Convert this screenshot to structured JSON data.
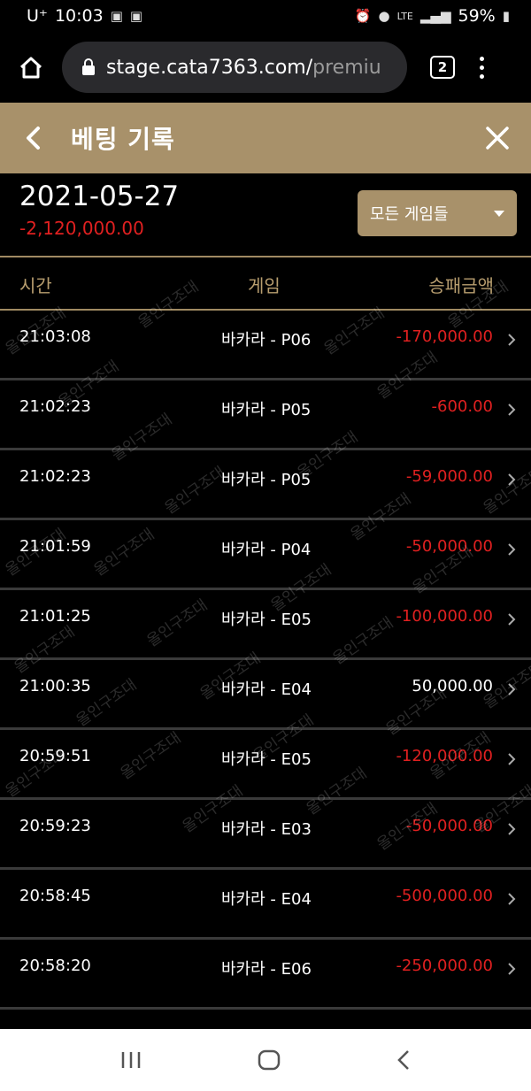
{
  "status_bar": {
    "carrier": "U⁺",
    "time": "10:03",
    "network": "LTE",
    "battery": "59%"
  },
  "browser": {
    "url_main": "stage.cata7363.com/",
    "url_rest": "premiu",
    "tab_count": "2"
  },
  "header": {
    "title": "베팅 기록"
  },
  "summary": {
    "date": "2021-05-27",
    "total": "-2,120,000.00",
    "game_filter": "모든 게임들"
  },
  "table": {
    "columns": [
      "시간",
      "게임",
      "승패금액"
    ],
    "rows": [
      {
        "time": "21:03:08",
        "game": "바카라 - P06",
        "amount": "-170,000.00",
        "negative": true
      },
      {
        "time": "21:02:23",
        "game": "바카라 - P05",
        "amount": "-600.00",
        "negative": true
      },
      {
        "time": "21:02:23",
        "game": "바카라 - P05",
        "amount": "-59,000.00",
        "negative": true
      },
      {
        "time": "21:01:59",
        "game": "바카라 - P04",
        "amount": "-50,000.00",
        "negative": true
      },
      {
        "time": "21:01:25",
        "game": "바카라 - E05",
        "amount": "-100,000.00",
        "negative": true
      },
      {
        "time": "21:00:35",
        "game": "바카라 - E04",
        "amount": "50,000.00",
        "negative": false
      },
      {
        "time": "20:59:51",
        "game": "바카라 - E05",
        "amount": "-120,000.00",
        "negative": true
      },
      {
        "time": "20:59:23",
        "game": "바카라 - E03",
        "amount": "-50,000.00",
        "negative": true
      },
      {
        "time": "20:58:45",
        "game": "바카라 - E04",
        "amount": "-500,000.00",
        "negative": true
      },
      {
        "time": "20:58:20",
        "game": "바카라 - E06",
        "amount": "-250,000.00",
        "negative": true
      }
    ]
  },
  "watermark": "올인구조대",
  "colors": {
    "accent_gold": "#a8916a",
    "negative_red": "#e02020",
    "background": "#000000"
  }
}
